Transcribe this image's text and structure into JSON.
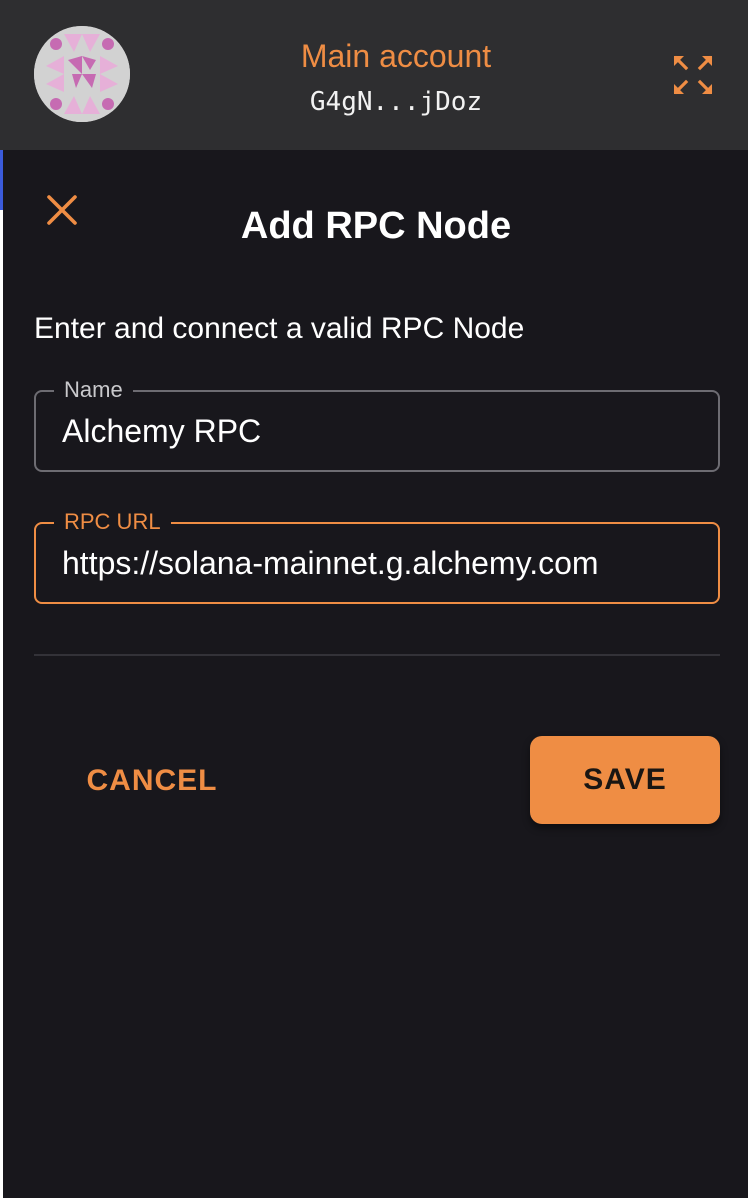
{
  "header": {
    "account_name": "Main account",
    "account_address": "G4gN...jDoz",
    "accent_color": "#ef8d44",
    "avatar_icon": "identicon-avatar",
    "expand_icon": "expand-icon"
  },
  "dialog": {
    "close_icon": "close-icon",
    "title": "Add RPC Node",
    "instructions": "Enter and connect a valid RPC Node",
    "fields": {
      "name": {
        "label": "Name",
        "value": "Alchemy RPC"
      },
      "rpc_url": {
        "label": "RPC URL",
        "value": "https://solana-mainnet.g.alchemy.com"
      }
    },
    "actions": {
      "cancel_label": "CANCEL",
      "save_label": "SAVE"
    }
  }
}
